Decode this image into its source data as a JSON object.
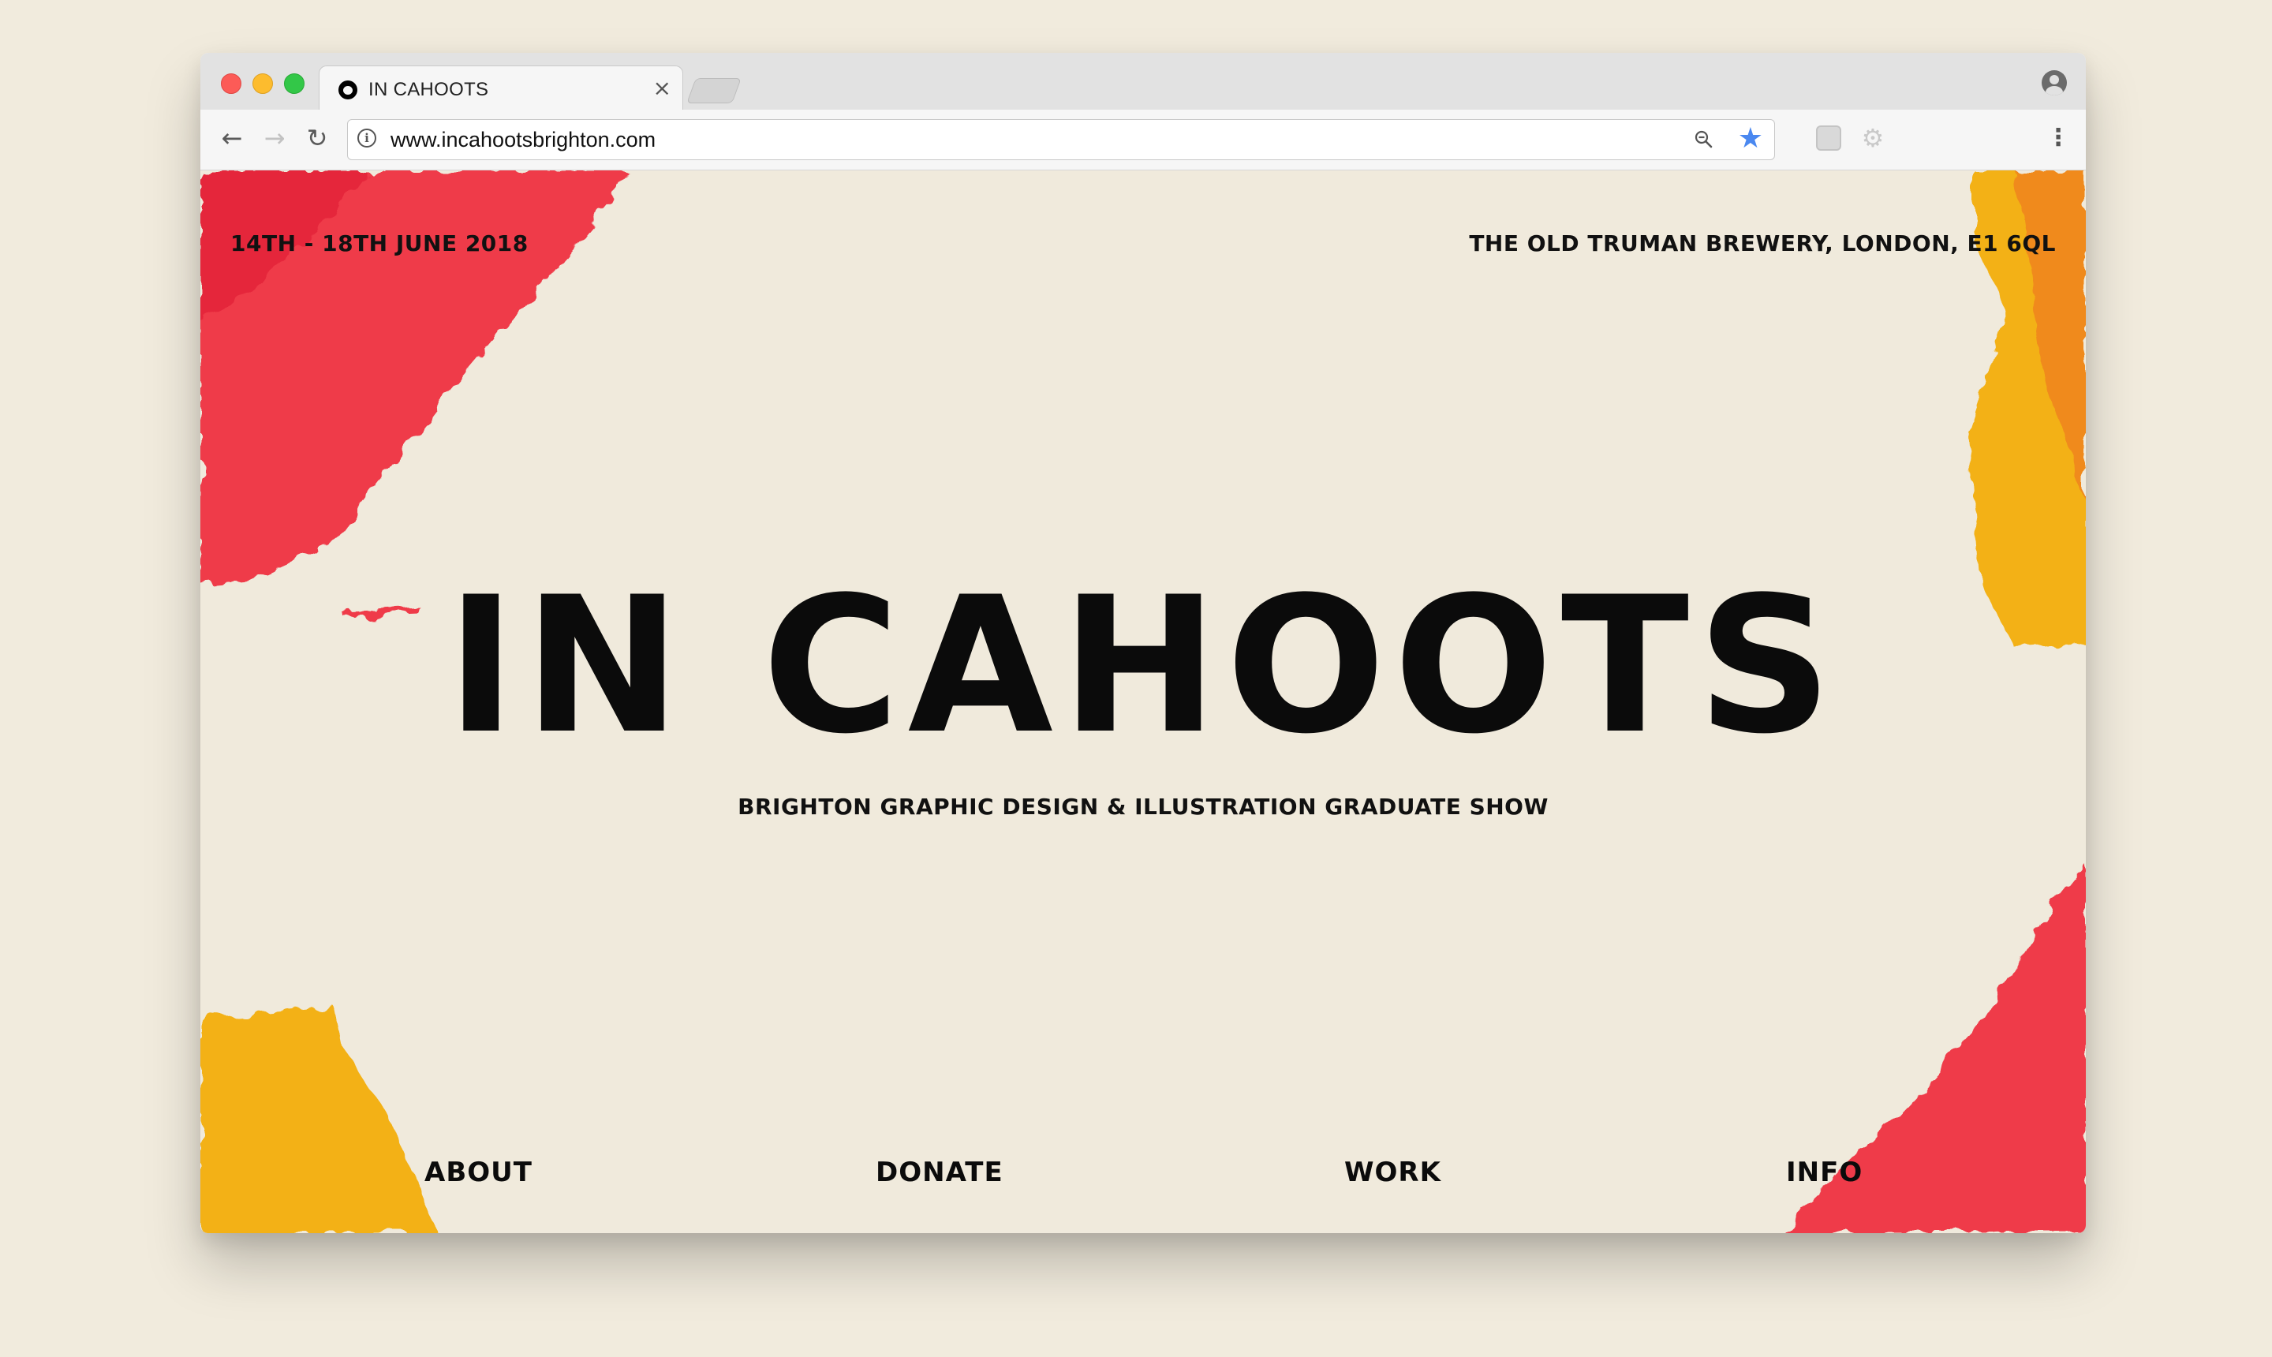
{
  "browser": {
    "tab_title": "IN CAHOOTS",
    "tab_close": "×",
    "url": "www.incahootsbrighton.com",
    "nav": {
      "back": "←",
      "forward": "→",
      "reload": "↻"
    },
    "info_glyph": "i",
    "star_glyph": "★",
    "menu_glyph": "⋮",
    "ext2_glyph": "⚙",
    "accent_color": "#4a88f0"
  },
  "page": {
    "dates": "14TH - 18TH JUNE 2018",
    "venue": "THE OLD TRUMAN BREWERY, LONDON, E1 6QL",
    "title": "IN CAHOOTS",
    "subtitle": "BRIGHTON GRAPHIC DESIGN & ILLUSTRATION GRADUATE SHOW",
    "nav": [
      {
        "label": "ABOUT"
      },
      {
        "label": "DONATE"
      },
      {
        "label": "WORK"
      },
      {
        "label": "INFO"
      }
    ],
    "colors": {
      "background": "#f0eadc",
      "red": "#ef3b4a",
      "yellow": "#f3b118",
      "orange": "#f08a1c",
      "text": "#0b0b0b"
    }
  }
}
